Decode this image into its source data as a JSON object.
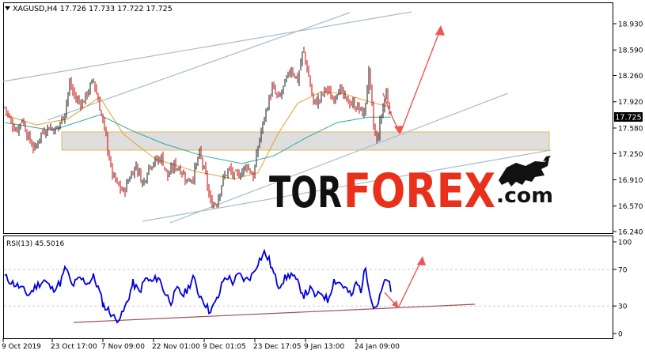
{
  "window": {
    "symbol_header": "XAGUSD,H4  17.726 17.733 17.722 17.725",
    "price_badge": "17.725",
    "rsi_header": "RSI(13) 45.5016",
    "watermark_tor": "TOR",
    "watermark_forex": "FOREX",
    "watermark_com": ".com"
  },
  "colors": {
    "bull_candle": "#1a1a1a",
    "bear_candle": "#cc0000",
    "ma_fast": "#e0a030",
    "ma_slow": "#2fa8a0",
    "channel": "#a8bccc",
    "rsi_line": "#0000dd",
    "rsi_trend": "#a05050",
    "arrow": "#ee5555",
    "zone_fill": "#dedede",
    "zone_border": "#e8c070",
    "watermark_dark": "#111111",
    "watermark_red": "#e8301a"
  },
  "chart_data": [
    {
      "type": "candlestick",
      "title": "XAGUSD,H4  17.726 17.733 17.722 17.725",
      "ylim": [
        16.24,
        19.1
      ],
      "y_ticks": [
        "18.930",
        "18.590",
        "18.260",
        "17.920",
        "17.580",
        "17.250",
        "16.910",
        "16.570",
        "16.240"
      ],
      "last_price": 17.725,
      "x_tick_labels": [
        "9 Oct 2019",
        "23 Oct 17:00",
        "7 Nov 09:00",
        "22 Nov 01:00",
        "9 Dec 01:05",
        "23 Dec 17:05",
        "9 Jan 13:00",
        "24 Jan 09:00"
      ],
      "close_path": [
        [
          0,
          17.85
        ],
        [
          8,
          17.65
        ],
        [
          15,
          17.55
        ],
        [
          22,
          17.7
        ],
        [
          30,
          17.45
        ],
        [
          38,
          17.3
        ],
        [
          45,
          17.5
        ],
        [
          55,
          17.6
        ],
        [
          65,
          17.55
        ],
        [
          75,
          17.75
        ],
        [
          82,
          18.15
        ],
        [
          90,
          17.95
        ],
        [
          98,
          17.9
        ],
        [
          105,
          18.05
        ],
        [
          112,
          18.2
        ],
        [
          120,
          17.85
        ],
        [
          128,
          17.45
        ],
        [
          135,
          17.0
        ],
        [
          142,
          16.85
        ],
        [
          150,
          16.75
        ],
        [
          158,
          16.95
        ],
        [
          166,
          17.1
        ],
        [
          175,
          16.85
        ],
        [
          182,
          17.1
        ],
        [
          190,
          17.15
        ],
        [
          198,
          17.2
        ],
        [
          206,
          16.95
        ],
        [
          214,
          17.1
        ],
        [
          222,
          17.05
        ],
        [
          230,
          16.9
        ],
        [
          238,
          16.95
        ],
        [
          246,
          17.25
        ],
        [
          254,
          16.95
        ],
        [
          260,
          16.6
        ],
        [
          268,
          16.62
        ],
        [
          275,
          16.9
        ],
        [
          283,
          17.05
        ],
        [
          290,
          16.95
        ],
        [
          298,
          17.0
        ],
        [
          306,
          17.1
        ],
        [
          314,
          16.95
        ],
        [
          322,
          17.45
        ],
        [
          330,
          17.8
        ],
        [
          338,
          18.1
        ],
        [
          346,
          17.95
        ],
        [
          354,
          18.15
        ],
        [
          362,
          18.35
        ],
        [
          370,
          18.2
        ],
        [
          377,
          18.6
        ],
        [
          383,
          18.3
        ],
        [
          390,
          17.9
        ],
        [
          398,
          17.95
        ],
        [
          406,
          18.1
        ],
        [
          414,
          17.95
        ],
        [
          422,
          18.1
        ],
        [
          430,
          17.95
        ],
        [
          438,
          17.9
        ],
        [
          446,
          17.85
        ],
        [
          454,
          17.75
        ],
        [
          460,
          18.3
        ],
        [
          466,
          17.6
        ],
        [
          470,
          17.4
        ],
        [
          476,
          17.75
        ],
        [
          482,
          18.05
        ],
        [
          488,
          17.73
        ]
      ],
      "ma_fast": [
        [
          0,
          17.75
        ],
        [
          40,
          17.62
        ],
        [
          80,
          17.7
        ],
        [
          120,
          17.98
        ],
        [
          150,
          17.5
        ],
        [
          190,
          17.18
        ],
        [
          240,
          17.02
        ],
        [
          290,
          16.92
        ],
        [
          320,
          17.0
        ],
        [
          345,
          17.5
        ],
        [
          370,
          17.9
        ],
        [
          400,
          18.05
        ],
        [
          430,
          18.02
        ],
        [
          460,
          17.92
        ],
        [
          488,
          17.85
        ]
      ],
      "ma_slow": [
        [
          0,
          17.65
        ],
        [
          60,
          17.55
        ],
        [
          120,
          17.75
        ],
        [
          160,
          17.55
        ],
        [
          200,
          17.38
        ],
        [
          250,
          17.22
        ],
        [
          300,
          17.12
        ],
        [
          340,
          17.22
        ],
        [
          380,
          17.45
        ],
        [
          420,
          17.65
        ],
        [
          460,
          17.72
        ],
        [
          488,
          17.72
        ]
      ]
    },
    {
      "type": "line",
      "title": "RSI(13) 45.5016",
      "ylim": [
        0,
        100
      ],
      "y_ticks": [
        "100",
        "70",
        "30",
        "0"
      ],
      "levels": [
        70,
        30
      ],
      "values": [
        [
          0,
          62
        ],
        [
          10,
          55
        ],
        [
          20,
          50
        ],
        [
          30,
          42
        ],
        [
          40,
          52
        ],
        [
          50,
          58
        ],
        [
          60,
          48
        ],
        [
          70,
          55
        ],
        [
          77,
          72
        ],
        [
          85,
          52
        ],
        [
          95,
          60
        ],
        [
          105,
          55
        ],
        [
          112,
          62
        ],
        [
          118,
          50
        ],
        [
          125,
          30
        ],
        [
          132,
          25
        ],
        [
          140,
          15
        ],
        [
          148,
          20
        ],
        [
          155,
          35
        ],
        [
          162,
          55
        ],
        [
          170,
          45
        ],
        [
          178,
          60
        ],
        [
          186,
          56
        ],
        [
          194,
          62
        ],
        [
          202,
          45
        ],
        [
          210,
          35
        ],
        [
          218,
          48
        ],
        [
          226,
          42
        ],
        [
          232,
          50
        ],
        [
          238,
          62
        ],
        [
          244,
          45
        ],
        [
          250,
          38
        ],
        [
          258,
          25
        ],
        [
          264,
          30
        ],
        [
          270,
          40
        ],
        [
          276,
          58
        ],
        [
          282,
          62
        ],
        [
          288,
          56
        ],
        [
          296,
          64
        ],
        [
          304,
          58
        ],
        [
          312,
          63
        ],
        [
          320,
          78
        ],
        [
          328,
          88
        ],
        [
          334,
          80
        ],
        [
          340,
          65
        ],
        [
          346,
          52
        ],
        [
          354,
          60
        ],
        [
          362,
          65
        ],
        [
          370,
          55
        ],
        [
          378,
          42
        ],
        [
          386,
          48
        ],
        [
          394,
          40
        ],
        [
          400,
          45
        ],
        [
          408,
          36
        ],
        [
          416,
          58
        ],
        [
          424,
          55
        ],
        [
          432,
          48
        ],
        [
          438,
          40
        ],
        [
          444,
          55
        ],
        [
          450,
          48
        ],
        [
          456,
          72
        ],
        [
          460,
          52
        ],
        [
          466,
          28
        ],
        [
          472,
          33
        ],
        [
          478,
          52
        ],
        [
          484,
          60
        ],
        [
          488,
          45.5
        ]
      ]
    }
  ]
}
